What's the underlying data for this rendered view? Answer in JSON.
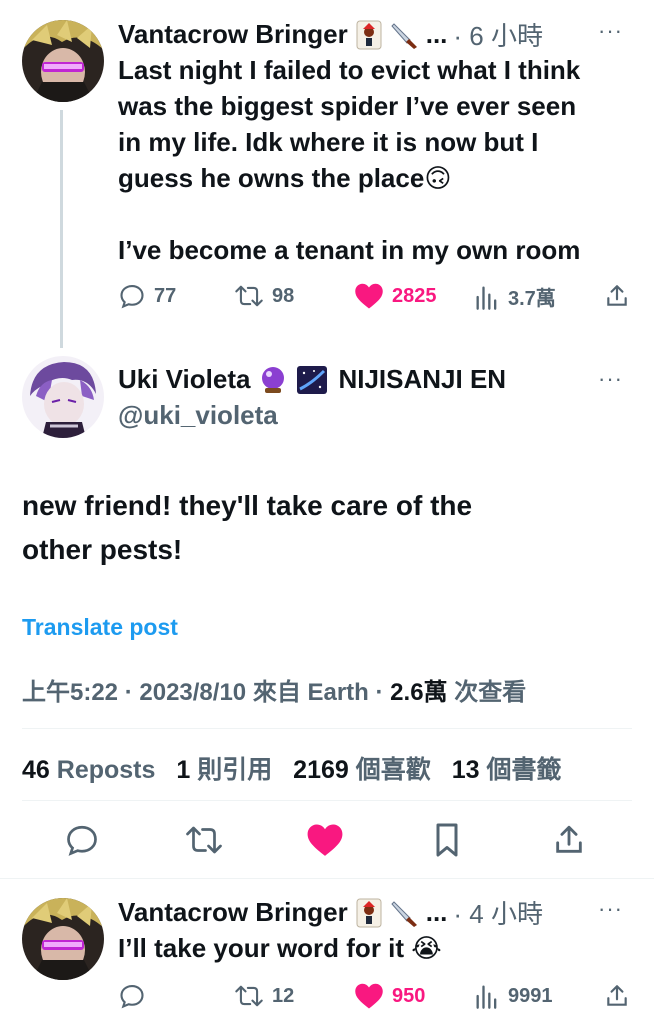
{
  "thread": {
    "parent": {
      "name": "Vantacrow Bringer",
      "ellipsis": "...",
      "time": "· 6 小時",
      "more": "···",
      "text_lines": [
        "Last night I failed to evict what I think",
        "was the biggest spider I’ve ever seen",
        "in my life. Idk where it is now but I",
        "guess he owns the place🙃"
      ],
      "text_line2": "I’ve become a tenant in my own room",
      "actions": {
        "replies": "77",
        "reposts": "98",
        "likes": "2825",
        "views": "3.7萬"
      }
    },
    "main": {
      "name": "Uki Violeta",
      "affiliation": "NIJISANJI EN",
      "handle": "@uki_violeta",
      "more": "···",
      "text_line1": "new friend! they'll take care of the",
      "text_line2": "other pests!",
      "translate": "Translate post",
      "meta": {
        "time": "上午5:22",
        "sep1": " · ",
        "date": "2023/8/10",
        "from": " 來自 Earth",
        "sep2": " · ",
        "views_num": "2.6萬",
        "views_label": " 次查看"
      },
      "stats": [
        {
          "num": "46",
          "label": " Reposts"
        },
        {
          "num": "1",
          "label": " 則引用"
        },
        {
          "num": "2169",
          "label": " 個喜歡"
        },
        {
          "num": "13",
          "label": " 個書籤"
        }
      ]
    },
    "reply": {
      "name": "Vantacrow Bringer",
      "ellipsis": "...",
      "time": "· 4 小時",
      "more": "···",
      "text": "I’ll take your word for it 😭",
      "actions": {
        "replies": "",
        "reposts": "12",
        "likes": "950",
        "views": "9991"
      }
    }
  },
  "colors": {
    "accent": "#1d9bf0",
    "like": "#f91880",
    "muted": "#536471",
    "text": "#0f1419"
  },
  "icons": [
    "reply-icon",
    "repost-icon",
    "heart-icon",
    "views-icon",
    "share-icon",
    "bookmark-icon",
    "crystal-ball-emoji",
    "galaxy-emoji",
    "joker-card-emoji",
    "knife-emoji"
  ]
}
